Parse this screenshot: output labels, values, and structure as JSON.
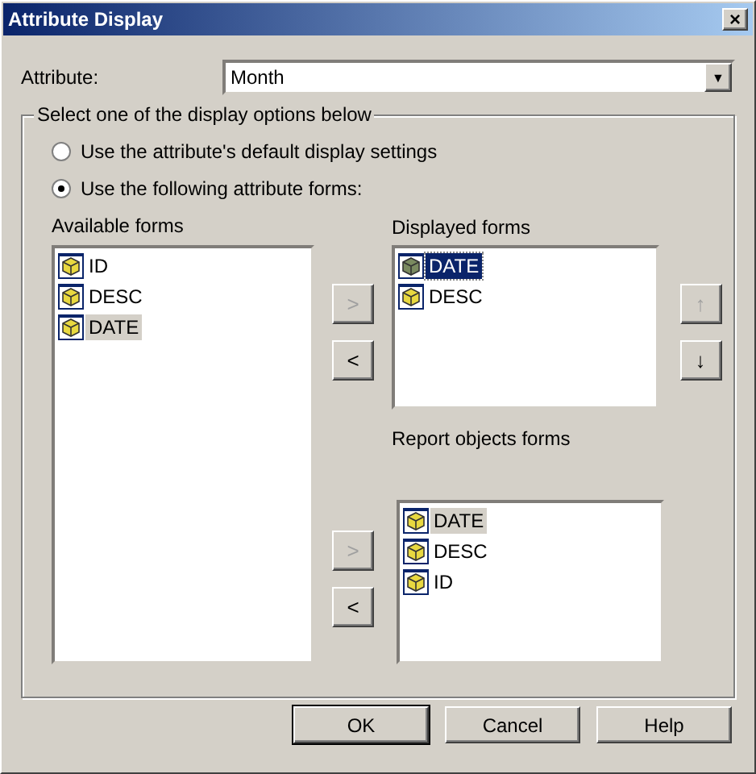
{
  "window": {
    "title": "Attribute Display",
    "close": "×"
  },
  "attribute": {
    "label": "Attribute:",
    "value": "Month",
    "arrow": "▼"
  },
  "group": {
    "legend": "Select one of the display options below",
    "options": [
      {
        "label": "Use the attribute's default display settings",
        "selected": false
      },
      {
        "label": "Use the following attribute forms:",
        "selected": true
      }
    ]
  },
  "available": {
    "label": "Available forms",
    "focused": false,
    "items": [
      {
        "label": "ID",
        "selected": false
      },
      {
        "label": "DESC",
        "selected": false
      },
      {
        "label": "DATE",
        "selected": true
      }
    ]
  },
  "displayed": {
    "label": "Displayed forms",
    "focused": true,
    "items": [
      {
        "label": "DATE",
        "selected": true
      },
      {
        "label": "DESC",
        "selected": false
      }
    ]
  },
  "report": {
    "label": "Report objects forms",
    "focused": false,
    "items": [
      {
        "label": "DATE",
        "selected": true
      },
      {
        "label": "DESC",
        "selected": false
      },
      {
        "label": "ID",
        "selected": false
      }
    ]
  },
  "move_buttons": [
    {
      "label": ">",
      "disabled": true
    },
    {
      "label": "<",
      "disabled": false
    }
  ],
  "report_move_buttons": [
    {
      "label": ">",
      "disabled": true
    },
    {
      "label": "<",
      "disabled": false
    }
  ],
  "order_buttons": [
    {
      "label": "↑",
      "disabled": true
    },
    {
      "label": "↓",
      "disabled": false
    }
  ],
  "buttons": [
    {
      "label": "OK",
      "default": true
    },
    {
      "label": "Cancel",
      "default": false
    },
    {
      "label": "Help",
      "default": false
    }
  ]
}
